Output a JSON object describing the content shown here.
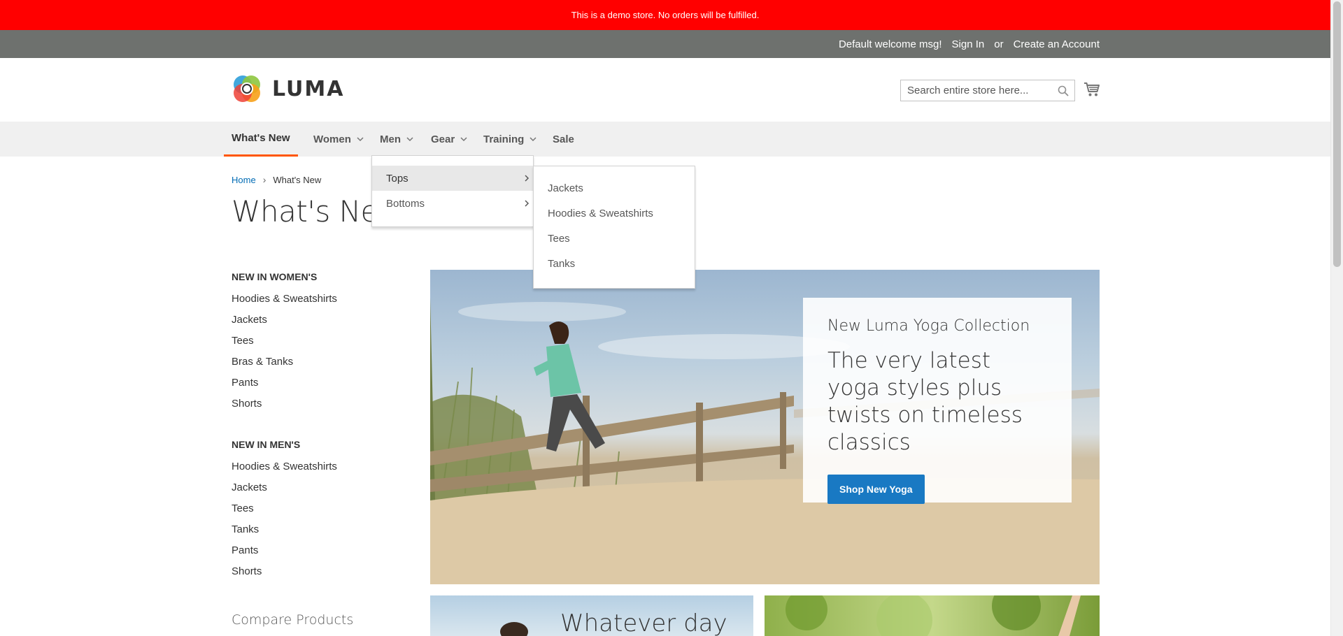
{
  "demo_notice": "This is a demo store. No orders will be fulfilled.",
  "panel_header": {
    "welcome": "Default welcome msg!",
    "sign_in": "Sign In",
    "or": "or",
    "create_account": "Create an Account"
  },
  "logo": {
    "text": "LUMA"
  },
  "search": {
    "placeholder": "Search entire store here...",
    "value": ""
  },
  "nav": {
    "whats_new": "What's New",
    "women": "Women",
    "men": "Men",
    "gear": "Gear",
    "training": "Training",
    "sale": "Sale"
  },
  "men_menu": {
    "items": [
      "Tops",
      "Bottoms"
    ],
    "tops_submenu": [
      "Jackets",
      "Hoodies & Sweatshirts",
      "Tees",
      "Tanks"
    ]
  },
  "breadcrumb": {
    "home": "Home",
    "separator": "›",
    "current": "What's New"
  },
  "page_title": "What's New",
  "sidebar": {
    "women": {
      "title": "NEW IN WOMEN'S",
      "links": [
        "Hoodies & Sweatshirts",
        "Jackets",
        "Tees",
        "Bras & Tanks",
        "Pants",
        "Shorts"
      ]
    },
    "men": {
      "title": "NEW IN MEN'S",
      "links": [
        "Hoodies & Sweatshirts",
        "Jackets",
        "Tees",
        "Tanks",
        "Pants",
        "Shorts"
      ]
    },
    "compare_title": "Compare Products"
  },
  "hero": {
    "kicker": "New Luma Yoga Collection",
    "headline": "The very latest yoga styles plus twists on timeless classics",
    "cta": "Shop New Yoga"
  },
  "promo_left": {
    "text": "Whatever day"
  },
  "colors": {
    "notice_bg": "#ff0000",
    "panel_bg": "#6e716e",
    "nav_bg": "#f0f0f0",
    "nav_active_border": "#ff5501",
    "link": "#006bb4",
    "cta_bg": "#1979c3"
  }
}
